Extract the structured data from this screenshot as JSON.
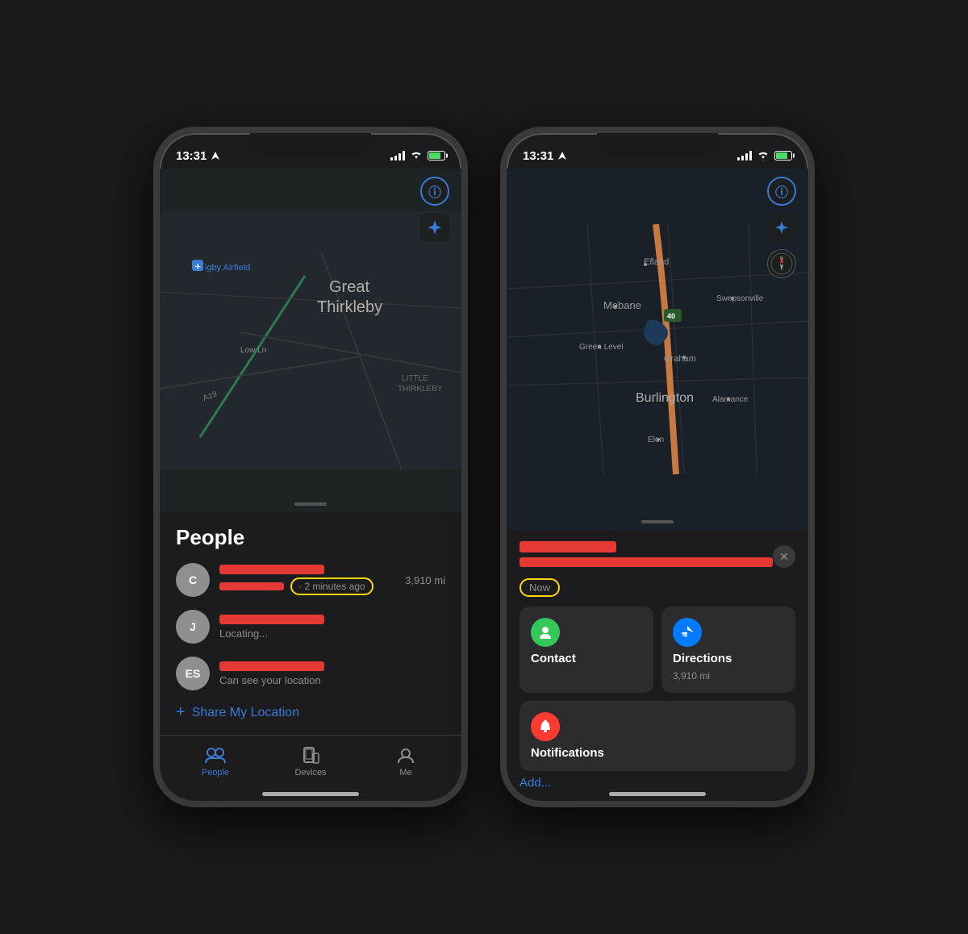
{
  "left_phone": {
    "status_bar": {
      "time": "13:31",
      "location_arrow": "▲"
    },
    "map": {
      "location_name": "Rigby Airfield",
      "place_name": "Great\nThirkleby",
      "sub_place": "LITTLE\nTHIRKLEBY",
      "road_label": "Low Ln",
      "road_label2": "A19"
    },
    "sheet": {
      "title": "People",
      "person_c": {
        "initials": "C",
        "time_label": "· 2 minutes ago",
        "distance": "3,910 mi"
      },
      "person_j": {
        "initials": "J",
        "status": "Locating..."
      },
      "person_es": {
        "initials": "ES",
        "status": "Can see your location"
      },
      "share_btn": "Share My Location"
    },
    "tab_bar": {
      "people_label": "People",
      "devices_label": "Devices",
      "me_label": "Me"
    }
  },
  "right_phone": {
    "status_bar": {
      "time": "13:31",
      "location_arrow": "▲"
    },
    "map": {
      "place_efland": "Efland",
      "place_mebane": "Mebane",
      "place_swepsonville": "Swepsonville",
      "place_green_level": "Green Level",
      "place_graham": "Graham",
      "place_burlington": "Burlington",
      "place_alamance": "Alamance",
      "place_elon": "Elon",
      "highway_40": "40"
    },
    "detail": {
      "now_label": "Now",
      "contact_label": "Contact",
      "directions_label": "Directions",
      "directions_distance": "3,910 mi",
      "notifications_label": "Notifications",
      "add_label": "Add..."
    }
  },
  "icons": {
    "info": "ⓘ",
    "locate": "➤",
    "compass": "N",
    "close": "✕",
    "people_tab": "👥",
    "devices_tab": "📱",
    "me_tab": "👤",
    "contact_icon": "👤",
    "directions_icon": "➤",
    "notifications_icon": "🔔",
    "plus": "+",
    "location": "⌖"
  },
  "colors": {
    "accent_blue": "#3a7bd5",
    "red_bar": "#e53935",
    "yellow_ring": "#ffd60a",
    "green_icon": "#34c759",
    "blue_icon": "#007aff",
    "red_notif": "#ff3b30",
    "tab_bg": "#1c1c1e",
    "map_dark": "#1a2028",
    "sheet_bg": "#2c2c2e"
  }
}
